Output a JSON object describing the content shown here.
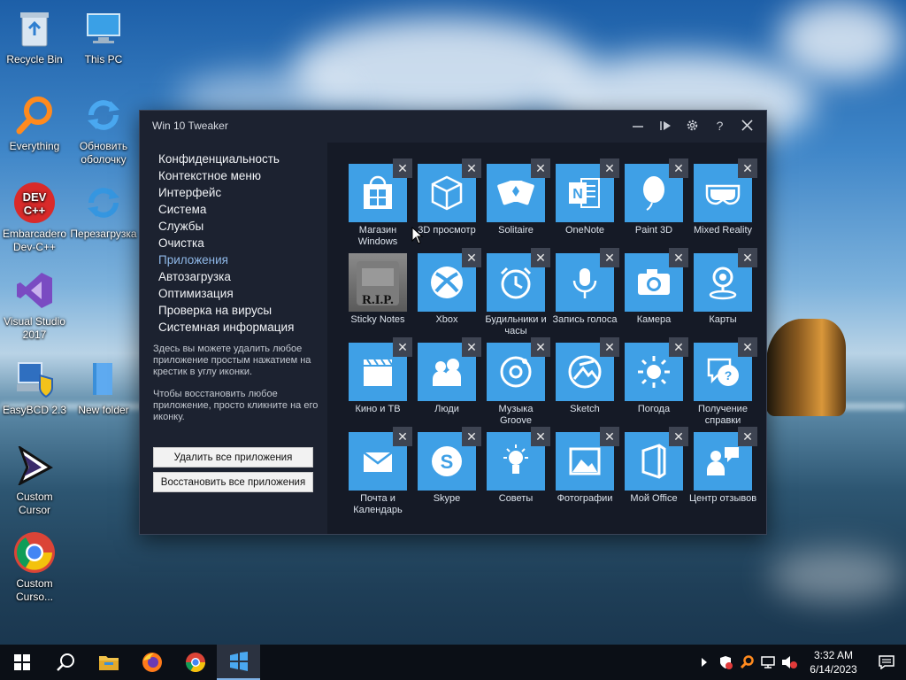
{
  "desktop": {
    "icons": [
      {
        "label": "Recycle Bin"
      },
      {
        "label": "This PC"
      },
      {
        "label": "Everything"
      },
      {
        "label": "Обновить оболочку"
      },
      {
        "label": "Embarcadero Dev-C++"
      },
      {
        "label": "Перезагрузка"
      },
      {
        "label": "Visual Studio 2017"
      },
      {
        "label": "EasyBCD 2.3"
      },
      {
        "label": "New folder"
      },
      {
        "label": "Custom Cursor"
      },
      {
        "label": "Custom Curso..."
      }
    ]
  },
  "window": {
    "title": "Win 10 Tweaker",
    "menu": [
      {
        "label": "Конфиденциальность"
      },
      {
        "label": "Контекстное меню"
      },
      {
        "label": "Интерфейс"
      },
      {
        "label": "Система"
      },
      {
        "label": "Службы"
      },
      {
        "label": "Очистка"
      },
      {
        "label": "Приложения",
        "active": true
      },
      {
        "label": "Автозагрузка"
      },
      {
        "label": "Оптимизация"
      },
      {
        "label": "Проверка на вирусы"
      },
      {
        "label": "Системная информация"
      }
    ],
    "help_text_1": "Здесь вы можете удалить любое приложение простым нажатием на крестик в углу иконки.",
    "help_text_2": "Чтобы восстановить любое приложение, просто кликните на его иконку.",
    "remove_all_label": "Удалить все приложения",
    "restore_all_label": "Восстановить все приложения",
    "remove_glyph": "✕",
    "tiles": [
      {
        "label": "Магазин Windows",
        "icon": "store-icon"
      },
      {
        "label": "3D просмотр",
        "icon": "cube-icon"
      },
      {
        "label": "Solitaire",
        "icon": "cards-icon"
      },
      {
        "label": "OneNote",
        "icon": "onenote-icon"
      },
      {
        "label": "Paint 3D",
        "icon": "paint3d-icon"
      },
      {
        "label": "Mixed Reality",
        "icon": "mixed-reality-icon"
      },
      {
        "label": "Sticky Notes",
        "icon": "rip-icon",
        "removed": true,
        "rip_text": "R.I.P."
      },
      {
        "label": "Xbox",
        "icon": "xbox-icon"
      },
      {
        "label": "Будильники и часы",
        "icon": "alarm-icon"
      },
      {
        "label": "Запись голоса",
        "icon": "microphone-icon"
      },
      {
        "label": "Камера",
        "icon": "camera-icon"
      },
      {
        "label": "Карты",
        "icon": "maps-icon"
      },
      {
        "label": "Кино и ТВ",
        "icon": "clapper-icon"
      },
      {
        "label": "Люди",
        "icon": "people-icon"
      },
      {
        "label": "Музыка Groove",
        "icon": "groove-icon"
      },
      {
        "label": "Sketch",
        "icon": "sketch-icon"
      },
      {
        "label": "Погода",
        "icon": "weather-icon"
      },
      {
        "label": "Получение справки",
        "icon": "help-icon"
      },
      {
        "label": "Почта и Календарь",
        "icon": "mail-icon"
      },
      {
        "label": "Skype",
        "icon": "skype-icon"
      },
      {
        "label": "Советы",
        "icon": "tips-icon"
      },
      {
        "label": "Фотографии",
        "icon": "photos-icon"
      },
      {
        "label": "Мой Office",
        "icon": "office-icon"
      },
      {
        "label": "Центр отзывов",
        "icon": "feedback-icon"
      }
    ]
  },
  "taskbar": {
    "time": "3:32 AM",
    "date": "6/14/2023"
  },
  "colors": {
    "tile_blue": "#3fa0e6",
    "window_bg": "#1c2230",
    "active_menu": "#8fb8e8"
  }
}
